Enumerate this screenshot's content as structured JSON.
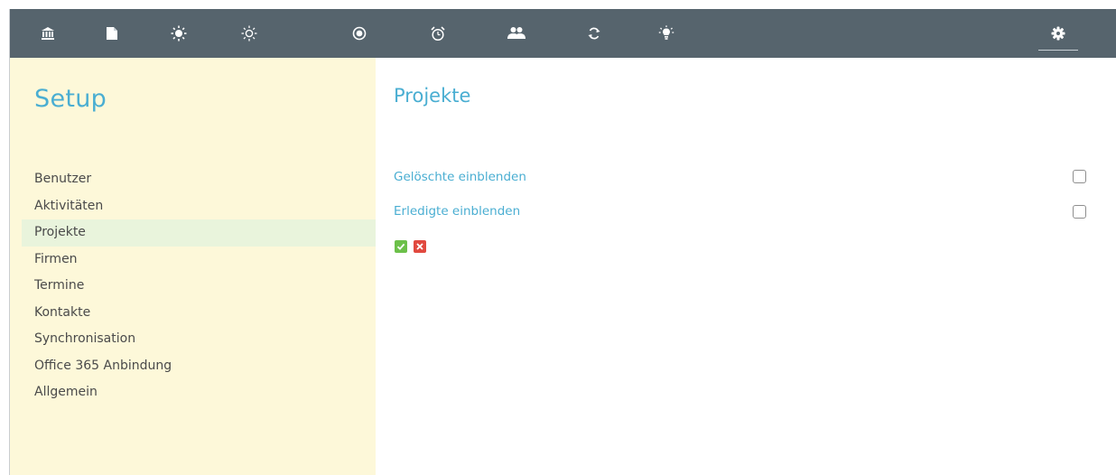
{
  "toolbar": {
    "icons": [
      {
        "name": "bank-icon"
      },
      {
        "name": "document-icon"
      },
      {
        "name": "sun-icon"
      },
      {
        "name": "sun-outline-icon"
      },
      {
        "name": "target-icon"
      },
      {
        "name": "alarm-clock-icon"
      },
      {
        "name": "users-icon"
      },
      {
        "name": "sync-icon"
      },
      {
        "name": "lightbulb-icon"
      },
      {
        "name": "gear-icon",
        "active": true
      }
    ],
    "background": "#56646d"
  },
  "sidebar": {
    "title": "Setup",
    "items": [
      {
        "label": "Benutzer"
      },
      {
        "label": "Aktivitäten"
      },
      {
        "label": "Projekte",
        "active": true
      },
      {
        "label": "Firmen"
      },
      {
        "label": "Termine"
      },
      {
        "label": "Kontakte"
      },
      {
        "label": "Synchronisation"
      },
      {
        "label": "Office 365 Anbindung"
      },
      {
        "label": "Allgemein"
      }
    ],
    "background": "#fdf8d9"
  },
  "main": {
    "title": "Projekte",
    "options": [
      {
        "label": "Gelöschte einblenden",
        "checked": false
      },
      {
        "label": "Erledigte einblenden",
        "checked": false
      }
    ],
    "actions": {
      "confirm": "confirm-icon",
      "cancel": "cancel-icon"
    },
    "accent": "#4aaed2"
  }
}
